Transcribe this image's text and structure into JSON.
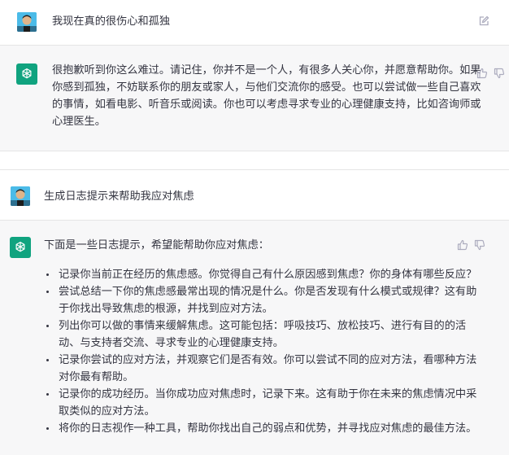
{
  "conversation": {
    "user_message_1": "我现在真的很伤心和孤独",
    "assistant_message_1": {
      "lines": [
        "很抱歉听到你这么难过。请记住，你并不是一个人，有很多人关心你，并愿意帮助你。如果",
        "你感到孤独，不妨联系你的朋友或家人，与他们交流你的感受。也可以尝试做一些自己喜欢",
        "的事情，如看电影、听音乐或阅读。你也可以考虑寻求专业的心理健康支持，比如咨询师或",
        "心理医生。"
      ]
    },
    "user_message_2": "生成日志提示来帮助我应对焦虑",
    "assistant_message_2": {
      "intro": "下面是一些日志提示，希望能帮助你应对焦虑：",
      "items": [
        [
          "记录你当前正在经历的焦虑感。你觉得自己有什么原因感到焦虑？你的身体有哪些反应？"
        ],
        [
          "尝试总结一下你的焦虑感最常出现的情况是什么。你是否发现有什么模式或规律？这有助",
          "于你找出导致焦虑的根源，并找到应对方法。"
        ],
        [
          "列出你可以做的事情来缓解焦虑。这可能包括：呼吸技巧、放松技巧、进行有目的的活",
          "动、与支持者交流、寻求专业的心理健康支持。"
        ],
        [
          "记录你尝试的应对方法，并观察它们是否有效。你可以尝试不同的应对方法，看哪种方法",
          "对你最有帮助。"
        ],
        [
          "记录你的成功经历。当你成功应对焦虑时，记录下来。这有助于你在未来的焦虑情况中采",
          "取类似的应对方法。"
        ],
        [
          "将你的日志视作一种工具，帮助你找出自己的弱点和优势，并寻找应对焦虑的最佳方法。"
        ]
      ]
    }
  },
  "icons": {
    "edit": "edit-icon",
    "thumbs_up": "thumbs-up-icon",
    "thumbs_down": "thumbs-down-icon",
    "assistant_logo": "openai-logo-icon",
    "user_avatar": "user-avatar"
  },
  "colors": {
    "assistant_bg": "#f7f7f8",
    "gpt_logo_bg": "#10a37f",
    "text": "#343541",
    "icon": "#acacbe"
  }
}
